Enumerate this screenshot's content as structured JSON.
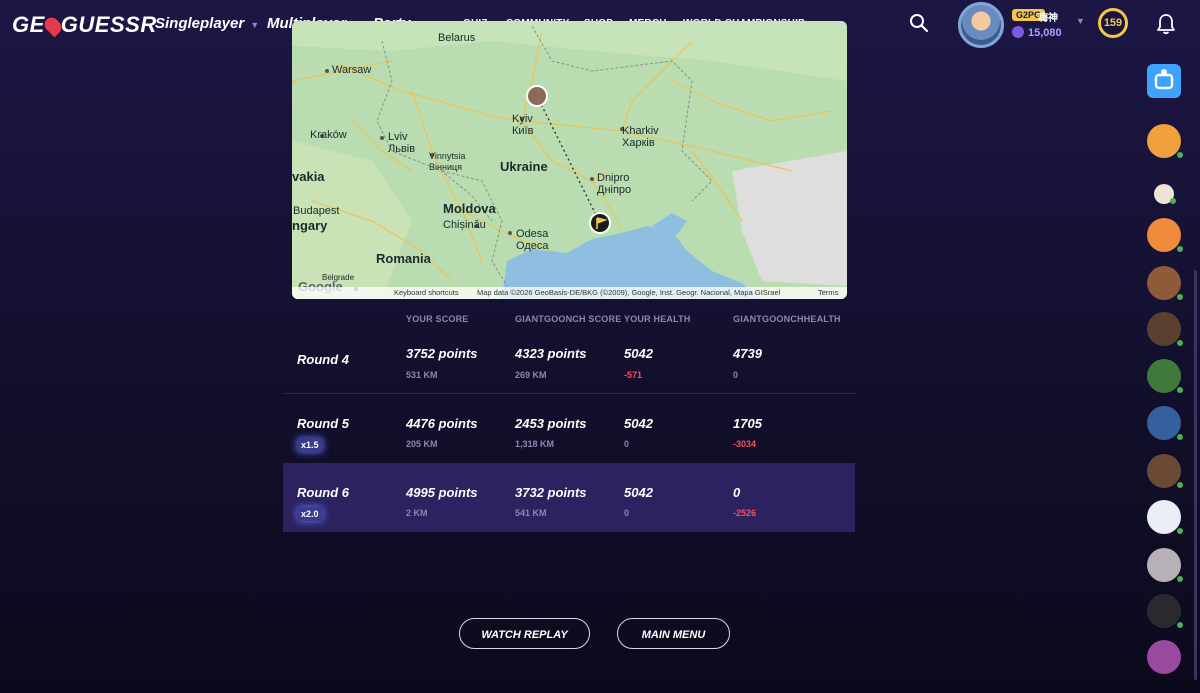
{
  "header": {
    "logo_text_left": "GE",
    "logo_text_right": "GUESSR",
    "nav_main": [
      "Singleplayer",
      "Multiplayer",
      "Party"
    ],
    "nav_small": [
      "QUIZ",
      "COMMUNITY",
      "SHOP",
      "MERCH",
      "WORLD CHAMPIONSHIP"
    ],
    "user": {
      "tag": "G2PG",
      "name": "嗨神",
      "coins": "15,080",
      "level": "159"
    }
  },
  "map": {
    "labels": {
      "belarus": "Belarus",
      "warsaw": "Warsaw",
      "krakow": "Kraków",
      "lviv": "Lviv",
      "lviv_local": "Львів",
      "kyiv": "Kyiv",
      "kyiv_local": "Київ",
      "kharkiv": "Kharkiv",
      "kharkiv_local": "Харків",
      "vinnytsia": "Vinnytsia",
      "vinnytsia_local": "Вінниця",
      "ukraine": "Ukraine",
      "slovakia": "vakia",
      "dnipro": "Dnipro",
      "dnipro_local": "Дніпро",
      "budapest": "Budapest",
      "hungary": "ngary",
      "moldova": "Moldova",
      "chisinau": "Chișinău",
      "odesa": "Odesa",
      "odesa_local": "Одеса",
      "romania": "Romania",
      "belgrade": "Belgrade",
      "google": "Google"
    },
    "footer": {
      "shortcuts": "Keyboard shortcuts",
      "attribution": "Map data ©2026 GeoBasis-DE/BKG (©2009), Google, Inst. Geogr. Nacional, Mapa GISrael",
      "terms": "Terms"
    }
  },
  "table": {
    "headers": [
      "YOUR SCORE",
      "GIANTGOONCH SCORE",
      "YOUR HEALTH",
      "GIANTGOONCHHEALTH"
    ],
    "rows": [
      {
        "round": "Round 4",
        "multiplier": "",
        "your_points": "3752 points",
        "your_dist": "531 KM",
        "opp_points": "4323 points",
        "opp_dist": "269 KM",
        "your_health": "5042",
        "your_delta": "-571",
        "opp_health": "4739",
        "opp_delta": "0"
      },
      {
        "round": "Round 5",
        "multiplier": "x1.5",
        "your_points": "4476 points",
        "your_dist": "205 KM",
        "opp_points": "2453 points",
        "opp_dist": "1,318 KM",
        "your_health": "5042",
        "your_delta": "0",
        "opp_health": "1705",
        "opp_delta": "-3034"
      },
      {
        "round": "Round 6",
        "multiplier": "x2.0",
        "your_points": "4995 points",
        "your_dist": "2 KM",
        "opp_points": "3732 points",
        "opp_dist": "541 KM",
        "your_health": "5042",
        "your_delta": "0",
        "opp_health": "0",
        "opp_delta": "-2526"
      }
    ]
  },
  "buttons": {
    "watch_replay": "WATCH REPLAY",
    "main_menu": "MAIN MENU"
  },
  "colors": {
    "accent": "#f4c64b",
    "negative": "#ff4d5e",
    "active_row": "#2c2260"
  }
}
